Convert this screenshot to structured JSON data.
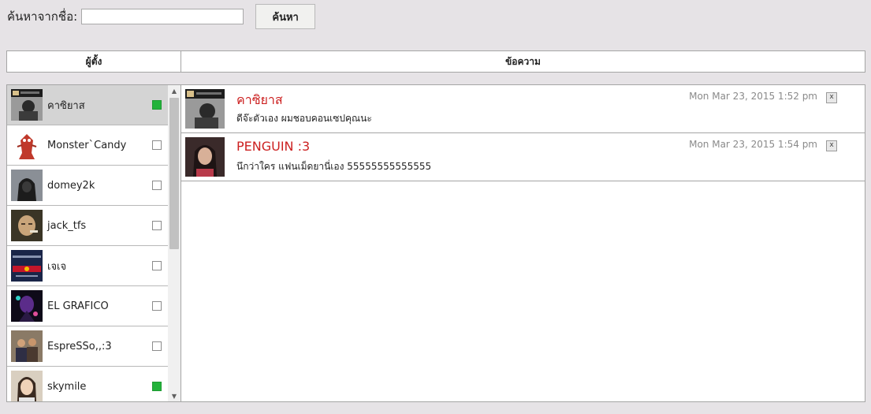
{
  "search": {
    "label": "ค้นหาจากชื่อ:",
    "value": "",
    "placeholder": "",
    "button_label": "ค้นหา"
  },
  "header": {
    "users_col": "ผู้ตั้ง",
    "messages_col": "ข้อความ"
  },
  "users": [
    {
      "name": "คาซิยาส",
      "online": true,
      "selected": true,
      "avatar": "photo-avatar"
    },
    {
      "name": "Monster`Candy",
      "online": false,
      "selected": false,
      "avatar": "monster-avatar"
    },
    {
      "name": "domey2k",
      "online": false,
      "selected": false,
      "avatar": "hooded-figure-avatar"
    },
    {
      "name": "jack_tfs",
      "online": false,
      "selected": false,
      "avatar": "face-avatar"
    },
    {
      "name": "เจเจ",
      "online": false,
      "selected": false,
      "avatar": "racing-logo-avatar"
    },
    {
      "name": "EL GRAFICO",
      "online": false,
      "selected": false,
      "avatar": "neon-figure-avatar"
    },
    {
      "name": "EspreSSo,,:3",
      "online": false,
      "selected": false,
      "avatar": "group-photo-avatar"
    },
    {
      "name": "skymile",
      "online": true,
      "selected": false,
      "avatar": "woman-photo-avatar"
    }
  ],
  "messages": [
    {
      "author": "คาซิยาส",
      "text": "ดีจ๊ะตัวเอง ผมชอบคอนเซปคุณนะ",
      "time": "Mon Mar 23, 2015 1:52 pm",
      "close_label": "x"
    },
    {
      "author": "PENGUIN :3",
      "text": "นึกว่าใคร แฟนเม็ดยานี่เอง 55555555555555",
      "time": "Mon Mar 23, 2015 1:54 pm",
      "close_label": "x"
    }
  ],
  "colors": {
    "background": "#e6e3e6",
    "author": "#cc2121",
    "online": "#23b33b",
    "selected_row": "#d4d4d4"
  }
}
